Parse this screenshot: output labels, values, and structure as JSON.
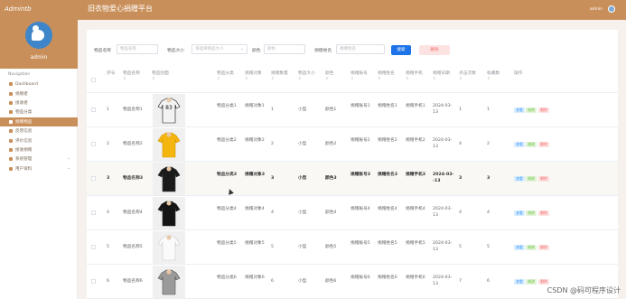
{
  "header": {
    "logo": "Admintb",
    "title": "旧衣物爱心捐赠平台",
    "user": "admin"
  },
  "sidebar": {
    "username": "admin",
    "nav_title": "Navigation",
    "items": [
      {
        "label": "Dashboard",
        "active": false
      },
      {
        "label": "捐赠者",
        "active": false
      },
      {
        "label": "接收者",
        "active": false
      },
      {
        "label": "物品分类",
        "active": false
      },
      {
        "label": "捐赠物品",
        "active": true
      },
      {
        "label": "反馈信息",
        "active": false
      },
      {
        "label": "评价信息",
        "active": false
      },
      {
        "label": "接收捐赠",
        "active": false
      },
      {
        "label": "系统管理",
        "active": false,
        "chevron": "⌄"
      },
      {
        "label": "用户资料",
        "active": false,
        "chevron": "⌄"
      }
    ]
  },
  "search": {
    "fields": [
      {
        "label": "物品名称",
        "placeholder": "物品名称"
      },
      {
        "label": "物品大小",
        "placeholder": "请选择物品大小",
        "select": true
      },
      {
        "label": "颜色",
        "placeholder": "颜色"
      },
      {
        "label": "捐赠姓名",
        "placeholder": "捐赠姓名"
      }
    ],
    "search_button": "搜索",
    "delete_button": "删除"
  },
  "table": {
    "columns": [
      {
        "label": "序号",
        "sub": ""
      },
      {
        "label": "物品名称",
        "sub": "⇕"
      },
      {
        "label": "物品封面",
        "sub": "⇕"
      },
      {
        "label": "物品分类",
        "sub": "⇕"
      },
      {
        "label": "捐赠对象",
        "sub": "⇕"
      },
      {
        "label": "捐赠数量",
        "sub": "⇕"
      },
      {
        "label": "物品大小",
        "sub": "⇕"
      },
      {
        "label": "颜色",
        "sub": "⇕"
      },
      {
        "label": "捐赠账号",
        "sub": "⇕"
      },
      {
        "label": "捐赠姓名",
        "sub": "⇕"
      },
      {
        "label": "捐赠手机",
        "sub": "⇕"
      },
      {
        "label": "捐赠日期",
        "sub": "⇕"
      },
      {
        "label": "点击次数",
        "sub": "⇕"
      },
      {
        "label": "收藏数",
        "sub": "⇕"
      },
      {
        "label": "操作",
        "sub": ""
      }
    ],
    "actions": {
      "view": "查看",
      "edit": "修改",
      "delete": "删除"
    },
    "rows": [
      {
        "idx": "1",
        "name": "物品名称1",
        "category": "物品分类1",
        "target": "捐赠对象1",
        "qty": "1",
        "size": "小型",
        "color": "颜色1",
        "account": "捐赠账号1",
        "donor": "捐赠姓名1",
        "phone": "捐赠手机1",
        "date_a": "2024-03-",
        "date_b": "13",
        "clicks": "1",
        "favs": "1",
        "thumb": "tshirt-white-black-print"
      },
      {
        "idx": "2",
        "name": "物品名称2",
        "category": "物品分类2",
        "target": "捐赠对象2",
        "qty": "2",
        "size": "小型",
        "color": "颜色2",
        "account": "捐赠账号2",
        "donor": "捐赠姓名2",
        "phone": "捐赠手机2",
        "date_a": "2024-03-",
        "date_b": "13",
        "clicks": "4",
        "favs": "2",
        "thumb": "polo-yellow"
      },
      {
        "idx": "3",
        "name": "物品名称3",
        "category": "物品分类3",
        "target": "捐赠对象3",
        "qty": "3",
        "size": "小型",
        "color": "颜色3",
        "account": "捐赠账号3",
        "donor": "捐赠姓名3",
        "phone": "捐赠手机3",
        "date_a": "2024-03-",
        "date_b": "-13",
        "clicks": "3",
        "favs": "3",
        "thumb": "tshirt-black"
      },
      {
        "idx": "4",
        "name": "物品名称4",
        "category": "物品分类4",
        "target": "捐赠对象4",
        "qty": "4",
        "size": "小型",
        "color": "颜色4",
        "account": "捐赠账号4",
        "donor": "捐赠姓名4",
        "phone": "捐赠手机4",
        "date_a": "2024-03-",
        "date_b": "13",
        "clicks": "4",
        "favs": "4",
        "thumb": "tshirt-black-vneck"
      },
      {
        "idx": "5",
        "name": "物品名称5",
        "category": "物品分类5",
        "target": "捐赠对象5",
        "qty": "5",
        "size": "小型",
        "color": "颜色5",
        "account": "捐赠账号5",
        "donor": "捐赠姓名5",
        "phone": "捐赠手机5",
        "date_a": "2024-03-",
        "date_b": "13",
        "clicks": "5",
        "favs": "5",
        "thumb": "tshirt-white"
      },
      {
        "idx": "6",
        "name": "物品名称6",
        "category": "物品分类6",
        "target": "捐赠对象6",
        "qty": "6",
        "size": "小型",
        "color": "颜色6",
        "account": "捐赠账号6",
        "donor": "捐赠姓名6",
        "phone": "捐赠手机6",
        "date_a": "2024-03-",
        "date_b": "13",
        "clicks": "7",
        "favs": "6",
        "thumb": "tshirt-grey"
      }
    ]
  },
  "watermark": "CSDN @码可程序设计",
  "colors": {
    "brand": "#c98f5a",
    "primary": "#1d74e8",
    "danger": "#f56c6c",
    "success": "#67c23a"
  }
}
